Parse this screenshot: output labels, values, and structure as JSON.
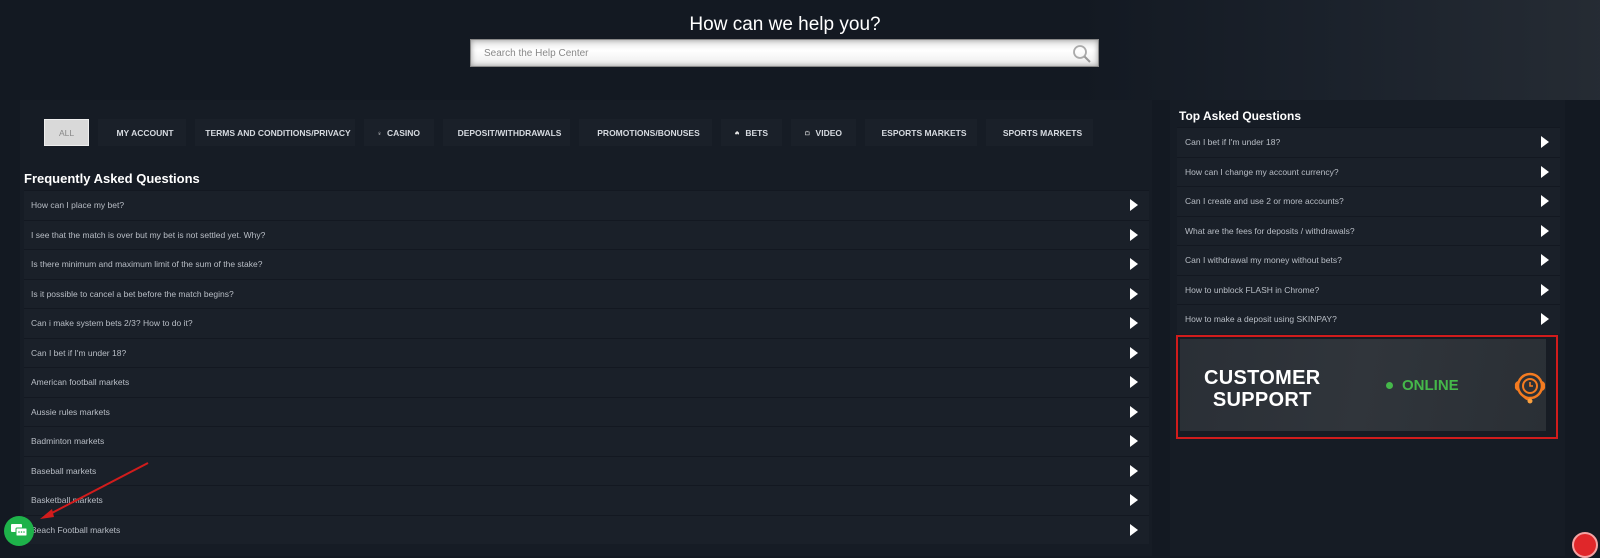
{
  "header": {
    "title": "How can we help you?",
    "search_placeholder": "Search the Help Center"
  },
  "tabs": [
    {
      "label": "ALL",
      "icon": "none",
      "active": true
    },
    {
      "label": "MY ACCOUNT",
      "icon": "user-icon"
    },
    {
      "label": "TERMS AND CONDITIONS/PRIVACY",
      "icon": "check-icon"
    },
    {
      "label": "CASINO",
      "icon": "casino-icon"
    },
    {
      "label": "DEPOSIT/WITHDRAWALS",
      "icon": "download-icon"
    },
    {
      "label": "PROMOTIONS/BONUSES",
      "icon": "promo-icon"
    },
    {
      "label": "BETS",
      "icon": "money-bag-icon"
    },
    {
      "label": "VIDEO",
      "icon": "tv-icon"
    },
    {
      "label": "ESPORTS MARKETS",
      "icon": "esports-icon"
    },
    {
      "label": "SPORTS MARKETS",
      "icon": "football-icon"
    }
  ],
  "faq": {
    "title": "Frequently Asked Questions",
    "items": [
      "How can I place my bet?",
      "I see that the match is over but my bet is not settled yet. Why?",
      "Is there minimum and maximum limit of the sum of the stake?",
      "Is it possible to cancel a bet before the match begins?",
      "Can i make system bets 2/3? How to do it?",
      "Can I bet if I'm under 18?",
      "American football markets",
      "Aussie rules markets",
      "Badminton markets",
      "Baseball markets",
      "Basketball markets",
      "Beach Football markets"
    ]
  },
  "top_asked": {
    "title": "Top Asked Questions",
    "items": [
      "Can I bet if I'm under 18?",
      "How can I change my account currency?",
      "Can I create and use 2 or more accounts?",
      "What are the fees for deposits / withdrawals?",
      "Can I withdrawal my money without bets?",
      "How to unblock FLASH in Chrome?",
      "How to make a deposit using SKINPAY?"
    ]
  },
  "support": {
    "line1": "CUSTOMER",
    "line2": "SUPPORT",
    "status": "ONLINE",
    "status_color": "#45b84a",
    "accent": "#f47b20"
  }
}
